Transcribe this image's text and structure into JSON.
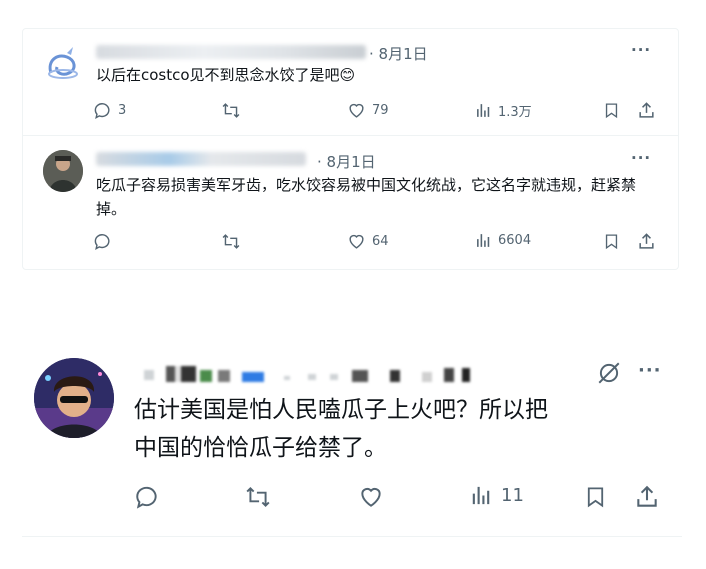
{
  "posts": [
    {
      "date": "· 8月1日",
      "text": "以后在costco见不到思念水饺了是吧😊",
      "metrics": {
        "replies": "3",
        "reposts": "",
        "likes": "79",
        "views": "1.3万"
      }
    },
    {
      "date": "· 8月1日",
      "text": "吃瓜子容易损害美军牙齿，吃水饺容易被中国文化统战，它这名字就违规，赶紧禁掉。",
      "metrics": {
        "replies": "",
        "reposts": "",
        "likes": "64",
        "views": "6604"
      }
    }
  ],
  "main_post": {
    "text_line1": "估计美国是怕人民嗑瓜子上火吧？所以把",
    "text_line2": "中国的恰恰瓜子给禁了。",
    "metrics": {
      "views": "11"
    }
  },
  "icons": {
    "reply": "reply-icon",
    "repost": "repost-icon",
    "like": "like-icon",
    "views": "views-icon",
    "bookmark": "bookmark-icon",
    "share": "share-icon",
    "more": "more-icon",
    "grok": "grok-icon"
  },
  "colors": {
    "icon_gray": "#536471",
    "border": "#eff3f4",
    "text": "#0f1419"
  }
}
